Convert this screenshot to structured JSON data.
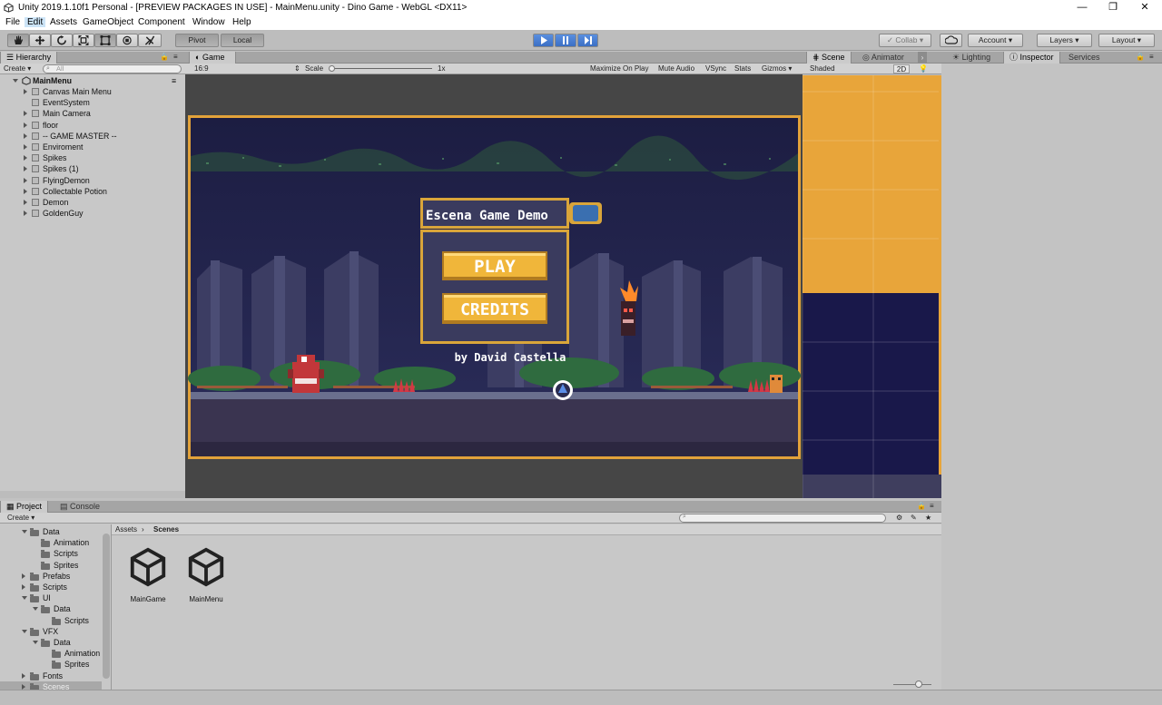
{
  "window": {
    "title": "Unity 2019.1.10f1 Personal - [PREVIEW PACKAGES IN USE] - MainMenu.unity - Dino Game - WebGL <DX11>",
    "controls": [
      "—",
      "❐",
      "✕"
    ]
  },
  "menu": [
    "File",
    "Edit",
    "Assets",
    "GameObject",
    "Component",
    "Window",
    "Help"
  ],
  "toolbar": {
    "pivot": "Pivot",
    "local": "Local",
    "collab": "Collab",
    "account": "Account",
    "layers": "Layers",
    "layout": "Layout"
  },
  "hierarchy": {
    "tab": "Hierarchy",
    "create": "Create",
    "search_placeholder": "All",
    "scene": "MainMenu",
    "items": [
      "Canvas Main Menu",
      "EventSystem",
      "Main Camera",
      "floor",
      "-- GAME MASTER --",
      "Enviroment",
      "Spikes",
      "Spikes (1)",
      "FlyingDemon",
      "Collectable Potion",
      "Demon",
      "GoldenGuy"
    ]
  },
  "game": {
    "tab": "Game",
    "aspect": "16:9",
    "scale_label": "Scale",
    "scale_value": "1x",
    "options": [
      "Maximize On Play",
      "Mute Audio",
      "VSync",
      "Stats",
      "Gizmos"
    ],
    "menu_title": "Escena Game Demo",
    "play": "PLAY",
    "credits": "CREDITS",
    "byline": "by David Castella"
  },
  "scene": {
    "tabs": [
      "Scene",
      "Animator"
    ],
    "shading": "Shaded",
    "mode": "2D"
  },
  "right_tabs": [
    "Lighting",
    "Inspector",
    "Services"
  ],
  "project": {
    "tabs": [
      "Project",
      "Console"
    ],
    "create": "Create",
    "breadcrumb": [
      "Assets",
      "Scenes"
    ],
    "tree": [
      {
        "label": "Data",
        "depth": 1,
        "open": true
      },
      {
        "label": "Animation",
        "depth": 2
      },
      {
        "label": "Scripts",
        "depth": 2
      },
      {
        "label": "Sprites",
        "depth": 2
      },
      {
        "label": "Prefabs",
        "depth": 1
      },
      {
        "label": "Scripts",
        "depth": 1
      },
      {
        "label": "UI",
        "depth": 1,
        "open": true
      },
      {
        "label": "Data",
        "depth": 2,
        "open": true
      },
      {
        "label": "Scripts",
        "depth": 3
      },
      {
        "label": "VFX",
        "depth": 1,
        "open": true
      },
      {
        "label": "Data",
        "depth": 2,
        "open": true
      },
      {
        "label": "Animation",
        "depth": 3
      },
      {
        "label": "Sprites",
        "depth": 3
      },
      {
        "label": "Fonts",
        "depth": 1
      },
      {
        "label": "Scenes",
        "depth": 1,
        "selected": true
      }
    ],
    "assets": [
      "MainGame",
      "MainMenu"
    ]
  },
  "colors": {
    "scene_orange": "#e8a53a",
    "scene_navy": "#19184a",
    "game_sky": "#1e1f45",
    "button_gold": "#f0b63a",
    "play_blue": "#3b6fc4"
  }
}
